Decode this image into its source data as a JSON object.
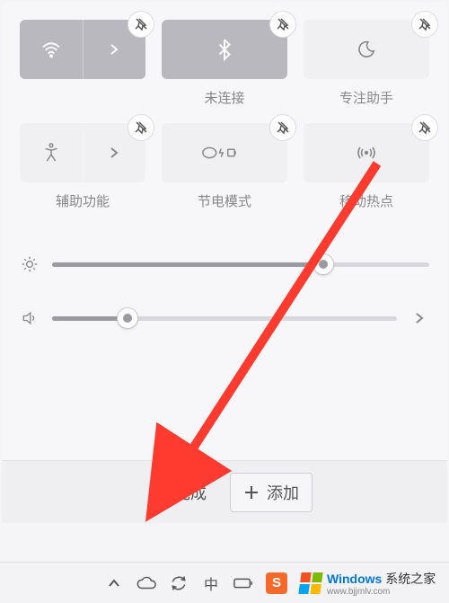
{
  "tiles": [
    {
      "icon": "wifi",
      "label": "",
      "active": true,
      "split": true
    },
    {
      "icon": "bluetooth",
      "label": "未连接",
      "active": true,
      "split": false
    },
    {
      "icon": "moon",
      "label": "专注助手",
      "active": false,
      "split": false
    },
    {
      "icon": "accessibility",
      "label": "辅助功能",
      "active": false,
      "split": true
    },
    {
      "icon": "battery",
      "label": "节电模式",
      "active": false,
      "split": false
    },
    {
      "icon": "hotspot",
      "label": "移动热点",
      "active": false,
      "split": false
    }
  ],
  "sliders": {
    "brightness": {
      "percent": 72
    },
    "volume": {
      "percent": 22
    }
  },
  "buttons": {
    "done": "完成",
    "add": "添加"
  },
  "watermark": {
    "brand": "Windows",
    "line1": "系统之家",
    "line2": "www.bjjmlv.com"
  },
  "annotation": {
    "color": "#ff3b2f"
  }
}
